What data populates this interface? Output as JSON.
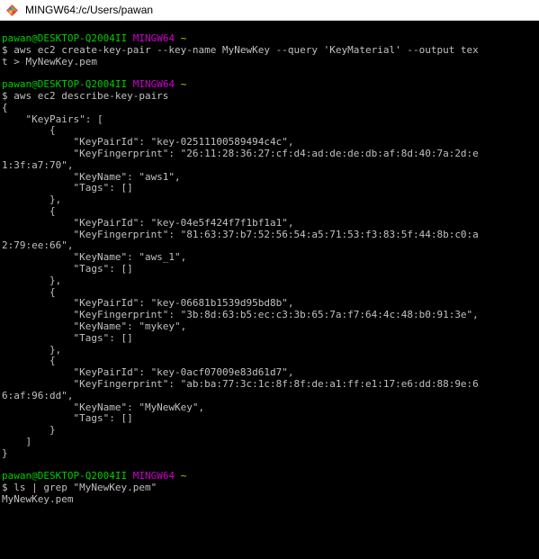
{
  "window": {
    "title": "MINGW64:/c/Users/pawan"
  },
  "terminal": {
    "prompt": {
      "user_host": "pawan@DESKTOP-Q2004II",
      "system": "MINGW64",
      "path": "~"
    },
    "blocks": [
      {
        "command_lines": [
          "$ aws ec2 create-key-pair --key-name MyNewKey --query 'KeyMaterial' --output tex",
          "t > MyNewKey.pem"
        ],
        "output_lines": []
      },
      {
        "command_lines": [
          "$ aws ec2 describe-key-pairs"
        ],
        "output_lines": [
          "{",
          "    \"KeyPairs\": [",
          "        {",
          "            \"KeyPairId\": \"key-02511100589494c4c\",",
          "            \"KeyFingerprint\": \"26:11:28:36:27:cf:d4:ad:de:de:db:af:8d:40:7a:2d:e",
          "1:3f:a7:70\",",
          "            \"KeyName\": \"aws1\",",
          "            \"Tags\": []",
          "        },",
          "        {",
          "            \"KeyPairId\": \"key-04e5f424f7f1bf1a1\",",
          "            \"KeyFingerprint\": \"81:63:37:b7:52:56:54:a5:71:53:f3:83:5f:44:8b:c0:a",
          "2:79:ee:66\",",
          "            \"KeyName\": \"aws_1\",",
          "            \"Tags\": []",
          "        },",
          "        {",
          "            \"KeyPairId\": \"key-06681b1539d95bd8b\",",
          "            \"KeyFingerprint\": \"3b:8d:63:b5:ec:c3:3b:65:7a:f7:64:4c:48:b0:91:3e\",",
          "            \"KeyName\": \"mykey\",",
          "            \"Tags\": []",
          "        },",
          "        {",
          "            \"KeyPairId\": \"key-0acf07009e83d61d7\",",
          "            \"KeyFingerprint\": \"ab:ba:77:3c:1c:8f:8f:de:a1:ff:e1:17:e6:dd:88:9e:6",
          "6:af:96:dd\",",
          "            \"KeyName\": \"MyNewKey\",",
          "            \"Tags\": []",
          "        }",
          "    ]",
          "}"
        ]
      },
      {
        "command_lines": [
          "$ ls | grep \"MyNewKey.pem\""
        ],
        "output_lines": [
          "MyNewKey.pem"
        ]
      }
    ]
  },
  "colors": {
    "background": "#000000",
    "text": "#c0c0c0",
    "prompt_user": "#00cd00",
    "prompt_system": "#cd00cd",
    "prompt_path": "#cdcd00"
  },
  "icons": {
    "app": "git-bash-diamond-icon"
  }
}
